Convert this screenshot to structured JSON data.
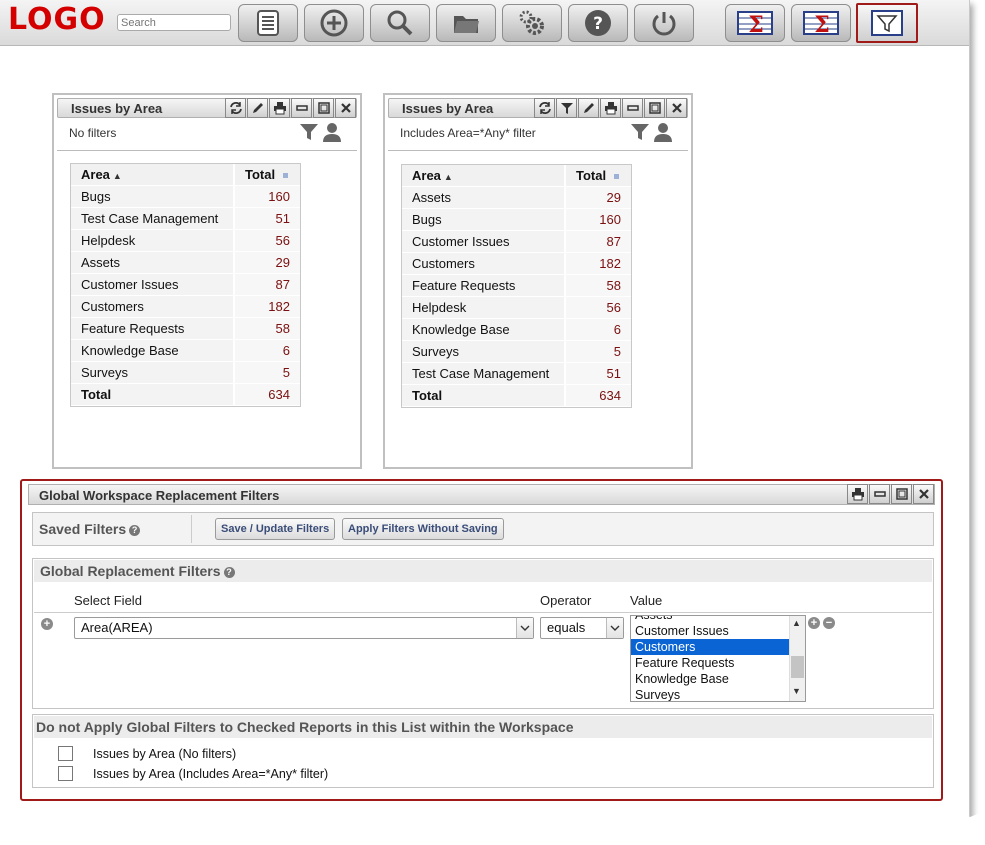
{
  "header": {
    "logo": "LOGO",
    "search_placeholder": "Search",
    "toolbar": [
      {
        "icon": "list-icon"
      },
      {
        "icon": "add-icon"
      },
      {
        "icon": "search-icon"
      },
      {
        "icon": "folder-icon"
      },
      {
        "icon": "gears-icon"
      },
      {
        "icon": "help-icon"
      },
      {
        "icon": "power-icon"
      }
    ],
    "report_buttons": [
      {
        "icon": "sigma-report-icon"
      },
      {
        "icon": "sigma-report-icon"
      },
      {
        "icon": "filter-icon",
        "selected": true
      }
    ]
  },
  "widgets": [
    {
      "title": "Issues by Area",
      "subtitle": "No filters",
      "col_area": "Area",
      "col_total": "Total",
      "rows": [
        {
          "area": "Bugs",
          "total": "160"
        },
        {
          "area": "Test Case Management",
          "total": "51"
        },
        {
          "area": "Helpdesk",
          "total": "56"
        },
        {
          "area": "Assets",
          "total": "29"
        },
        {
          "area": "Customer Issues",
          "total": "87"
        },
        {
          "area": "Customers",
          "total": "182"
        },
        {
          "area": "Feature Requests",
          "total": "58"
        },
        {
          "area": "Knowledge Base",
          "total": "6"
        },
        {
          "area": "Surveys",
          "total": "5"
        }
      ],
      "total_label": "Total",
      "total_value": "634"
    },
    {
      "title": "Issues by Area",
      "subtitle": "Includes Area=*Any* filter",
      "col_area": "Area",
      "col_total": "Total",
      "rows": [
        {
          "area": "Assets",
          "total": "29"
        },
        {
          "area": "Bugs",
          "total": "160"
        },
        {
          "area": "Customer Issues",
          "total": "87"
        },
        {
          "area": "Customers",
          "total": "182"
        },
        {
          "area": "Feature Requests",
          "total": "58"
        },
        {
          "area": "Helpdesk",
          "total": "56"
        },
        {
          "area": "Knowledge Base",
          "total": "6"
        },
        {
          "area": "Surveys",
          "total": "5"
        },
        {
          "area": "Test Case Management",
          "total": "51"
        }
      ],
      "total_label": "Total",
      "total_value": "634"
    }
  ],
  "global_filters": {
    "title": "Global Workspace Replacement Filters",
    "saved_filters_label": "Saved Filters",
    "save_update_button": "Save / Update Filters",
    "apply_without_saving_button": "Apply Filters Without Saving",
    "replacement_section_title": "Global Replacement Filters",
    "col_select_field": "Select Field",
    "col_operator": "Operator",
    "col_value": "Value",
    "field_value": "Area(AREA)",
    "operator_value": "equals",
    "value_options": [
      "Assets",
      "Customer Issues",
      "Customers",
      "Feature Requests",
      "Knowledge Base",
      "Surveys"
    ],
    "selected_value": "Customers",
    "exclude_section_title": "Do not Apply Global Filters to Checked Reports in this List within the Workspace",
    "exclude_reports": [
      {
        "label": "Issues by Area (No filters)",
        "checked": false
      },
      {
        "label": "Issues by Area (Includes Area=*Any* filter)",
        "checked": false
      }
    ]
  }
}
